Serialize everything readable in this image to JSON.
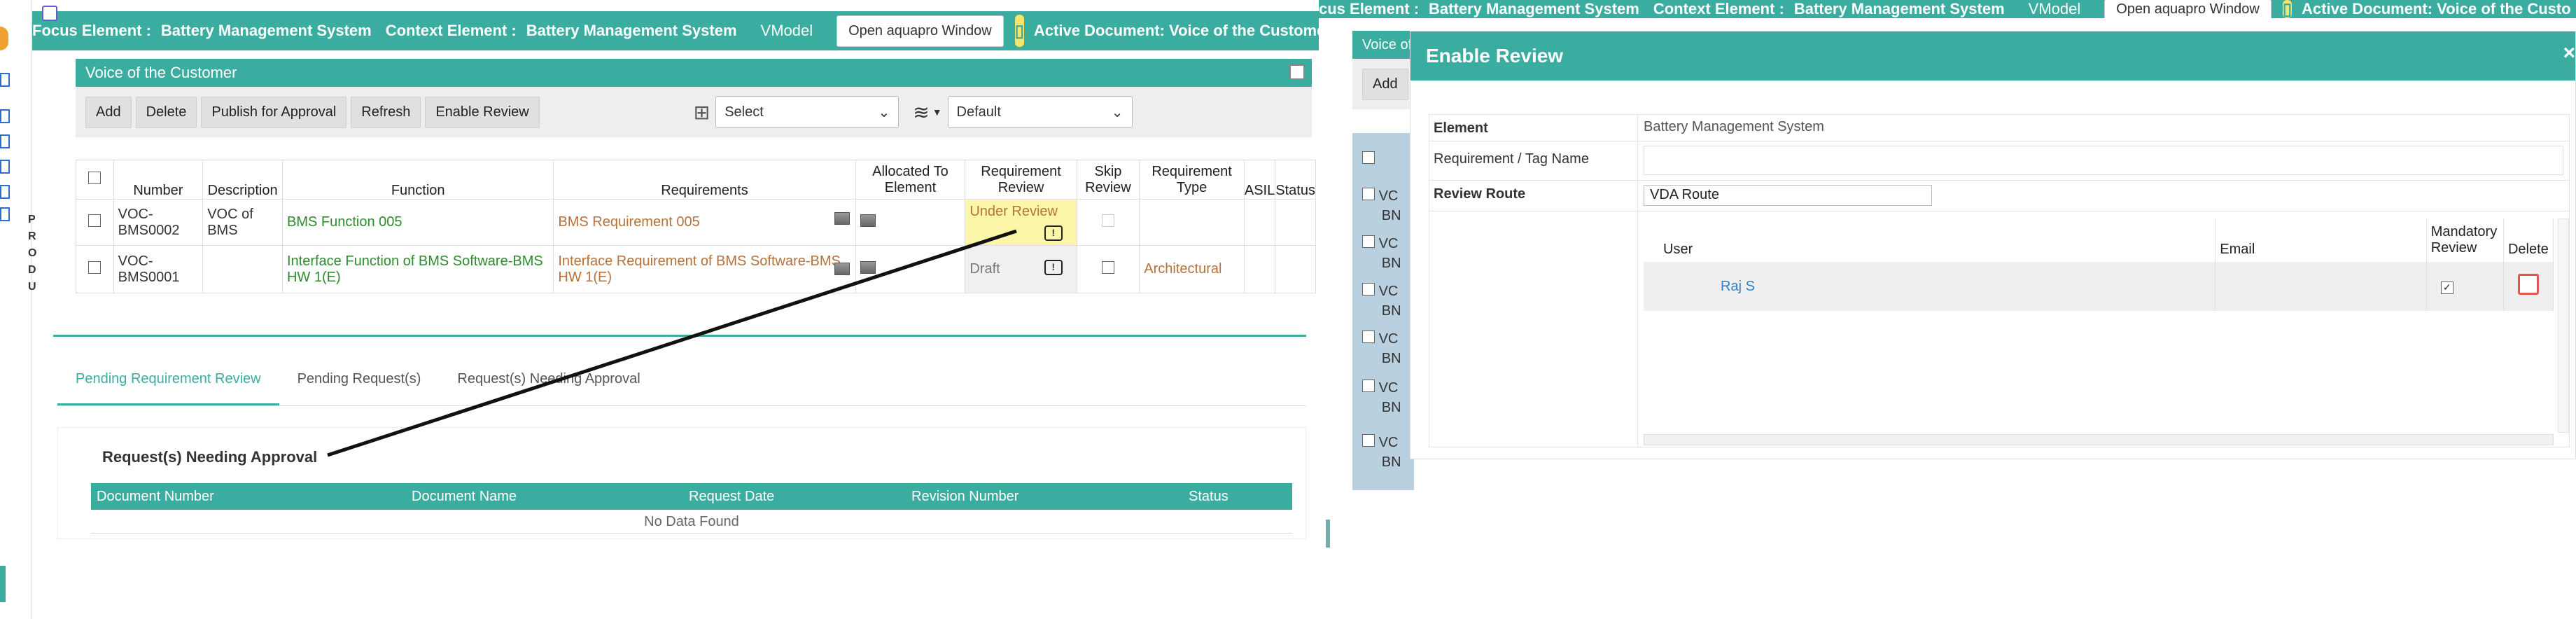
{
  "left": {
    "top_bar": {
      "focus_label": "Focus Element :",
      "focus_value": "Battery Management System",
      "context_label": "Context Element :",
      "context_value": "Battery Management System",
      "vmodel": "VModel",
      "open_window": "Open aquapro Window",
      "active_document": "Active Document: Voice of the Customer"
    },
    "side_letters": [
      "P",
      "R",
      "O",
      "D",
      "U"
    ],
    "panel_title": "Voice of the Customer",
    "toolbar": {
      "add": "Add",
      "delete": "Delete",
      "publish": "Publish for Approval",
      "refresh": "Refresh",
      "enable_review": "Enable Review",
      "select1": "Select",
      "select2": "Default"
    },
    "table": {
      "headers": [
        "Number",
        "Description",
        "Function",
        "Requirements",
        "Allocated To Element",
        "Requirement Review",
        "Skip Review",
        "Requirement Type",
        "ASIL",
        "Status"
      ],
      "rows": [
        {
          "number": "VOC-BMS0002",
          "description": "VOC of BMS",
          "function": "BMS Function 005",
          "requirement": "BMS Requirement 005",
          "review": "Under Review",
          "type": ""
        },
        {
          "number": "VOC-BMS0001",
          "description": "",
          "function": "Interface Function of BMS Software-BMS HW 1(E)",
          "requirement": "Interface Requirement of BMS Software-BMS HW 1(E)",
          "review": "Draft",
          "type": "Architectural"
        }
      ]
    },
    "tabs": [
      "Pending Requirement Review",
      "Pending Request(s)",
      "Request(s) Needing Approval"
    ],
    "section_title": "Request(s) Needing Approval",
    "requests": {
      "headers": [
        "Document Number",
        "Document Name",
        "Request Date",
        "Revision Number",
        "Status"
      ],
      "empty": "No Data Found"
    }
  },
  "right": {
    "top_bar": {
      "focus_label": "cus Element :",
      "focus_value": "Battery Management System",
      "context_label": "Context Element :",
      "context_value": "Battery Management System",
      "vmodel": "VModel",
      "open_window": "Open aquapro Window",
      "active_document": "Active Document: Voice of the Custo"
    },
    "behind_rows": [
      "VC",
      "VC",
      "VC",
      "VC",
      "VC",
      "VC"
    ],
    "behind_rows2": [
      "BN",
      "BN",
      "BN",
      "BN",
      "BN",
      "BN"
    ],
    "behind_title": "Voice of",
    "behind_add": "Add",
    "dialog": {
      "title": "Enable Review",
      "close": "×",
      "element_label": "Element",
      "element_value": "Battery Management System",
      "tag_label": "Requirement / Tag Name",
      "route_label": "Review Route",
      "route_value": "VDA Route",
      "users": {
        "headers": [
          "User",
          "Email",
          "Mandatory Review",
          "Delete"
        ],
        "rows": [
          {
            "user": "Raj S",
            "email": ""
          }
        ]
      }
    }
  },
  "colors": {
    "teal": "#3aada0",
    "yellow": "#fbf7a6",
    "green_text": "#2e8b2e",
    "brown_text": "#b7713a"
  }
}
